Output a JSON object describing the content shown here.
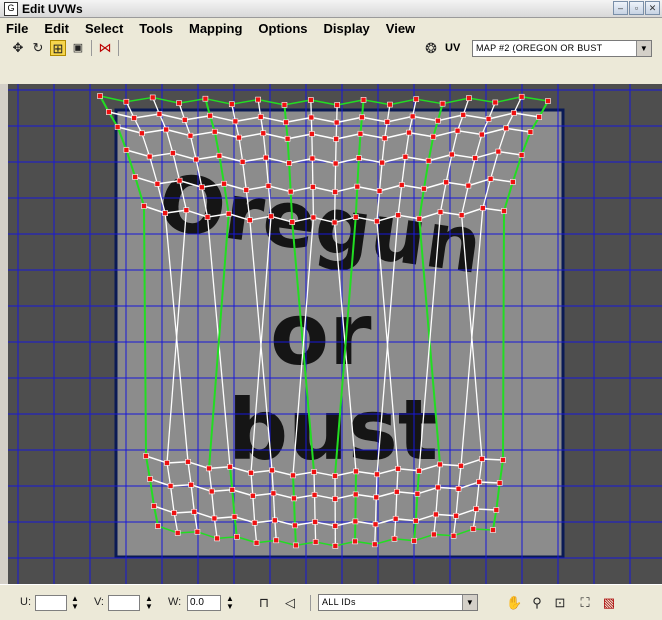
{
  "window": {
    "title": "Edit UVWs",
    "icons": [
      "app-icon",
      "minimize-icon",
      "restore-icon",
      "close-icon"
    ]
  },
  "menu": [
    "File",
    "Edit",
    "Select",
    "Tools",
    "Mapping",
    "Options",
    "Display",
    "View"
  ],
  "toolbar": {
    "tools": [
      "move-icon",
      "rotate-icon",
      "scale-icon",
      "freeform-icon",
      "mirror-icon"
    ],
    "uv_label": "UV",
    "map_select": "MAP #2 (OREGON OR BUST"
  },
  "texture_text": [
    "Oregun",
    "or",
    "bust"
  ],
  "bottom": {
    "u_label": "U:",
    "u_value": "",
    "v_label": "V:",
    "v_value": "",
    "w_label": "W:",
    "w_value": "0.0",
    "ids_select": "ALL IDs",
    "nav_icons": [
      "pan-icon",
      "zoom-icon",
      "zoom-region-icon",
      "zoom-extents-icon",
      "texture-toggle-icon"
    ]
  },
  "colors": {
    "grid": "#1818d8",
    "mesh_edge": "#ffffff",
    "seam_edge": "#22dd22",
    "vertex": "#ee1111",
    "texture_bg": "#8a8a8a"
  }
}
